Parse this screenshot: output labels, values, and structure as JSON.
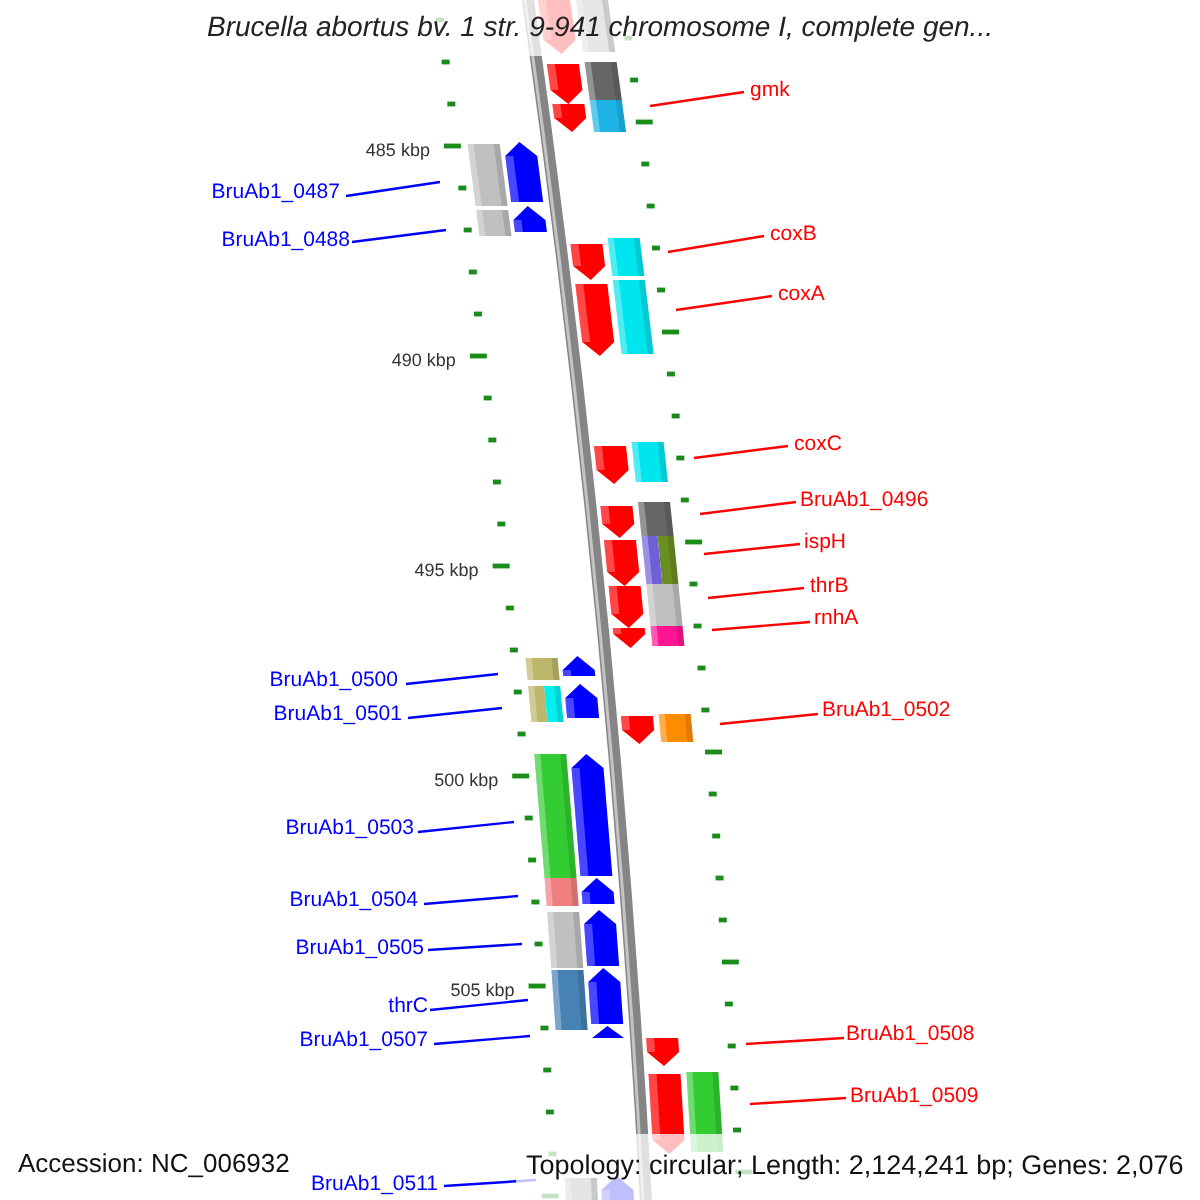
{
  "title": "Brucella abortus bv. 1 str. 9-941 chromosome I, complete gen...",
  "scale_labels": [
    "485 kbp",
    "490 kbp",
    "495 kbp",
    "500 kbp",
    "505 kbp"
  ],
  "genes": [
    {
      "kind": "forward",
      "blocks": [
        {
          "color": "#e6e6e6"
        }
      ]
    },
    {
      "kind": "forward",
      "blocks": [
        {
          "color": "#666666"
        }
      ]
    },
    {
      "label": "gmk",
      "kind": "forward",
      "blocks": [
        {
          "color": "#1eb4e6"
        }
      ]
    },
    {
      "label": "BruAb1_0487",
      "kind": "reverse",
      "blocks": [
        {
          "color": "#c0c0c0"
        }
      ]
    },
    {
      "label": "BruAb1_0488",
      "kind": "reverse",
      "blocks": [
        {
          "color": "#c0c0c0"
        }
      ]
    },
    {
      "label": "coxB",
      "kind": "forward",
      "blocks": [
        {
          "color": "#00e5ee"
        }
      ]
    },
    {
      "label": "coxA",
      "kind": "forward",
      "blocks": [
        {
          "color": "#00e5ee"
        }
      ]
    },
    {
      "label": "coxC",
      "kind": "forward",
      "blocks": [
        {
          "color": "#00e5ee"
        }
      ]
    },
    {
      "label": "BruAb1_0496",
      "kind": "forward",
      "blocks": [
        {
          "color": "#666666"
        }
      ]
    },
    {
      "label": "ispH",
      "kind": "forward",
      "blocks": [
        {
          "color": "#7060d8"
        },
        {
          "color": "#6b8e23"
        }
      ]
    },
    {
      "label": "thrB",
      "kind": "forward",
      "blocks": [
        {
          "color": "#c0c0c0"
        }
      ]
    },
    {
      "label": "rnhA",
      "kind": "forward",
      "blocks": [
        {
          "color": "#ff1493"
        }
      ]
    },
    {
      "label": "BruAb1_0500",
      "kind": "reverse",
      "blocks": [
        {
          "color": "#bdb76b"
        }
      ]
    },
    {
      "label": "BruAb1_0501",
      "kind": "reverse",
      "blocks": [
        {
          "color": "#bdb76b"
        },
        {
          "color": "#00f0f0"
        }
      ]
    },
    {
      "label": "BruAb1_0502",
      "kind": "forward",
      "blocks": [
        {
          "color": "#ff8c00"
        }
      ]
    },
    {
      "label": "BruAb1_0503",
      "kind": "reverse",
      "blocks": [
        {
          "color": "#33cc33"
        }
      ]
    },
    {
      "label": "BruAb1_0504",
      "kind": "reverse",
      "blocks": [
        {
          "color": "#f08080"
        }
      ]
    },
    {
      "label": "BruAb1_0505",
      "kind": "reverse",
      "blocks": [
        {
          "color": "#c0c0c0"
        }
      ]
    },
    {
      "label": "thrC",
      "kind": "reverse",
      "blocks": [
        {
          "color": "#4682b4"
        }
      ]
    },
    {
      "label": "BruAb1_0507",
      "kind": "reverse"
    },
    {
      "label": "BruAb1_0508",
      "kind": "forward"
    },
    {
      "label": "BruAb1_0509",
      "kind": "forward",
      "blocks": [
        {
          "color": "#33cc33"
        }
      ]
    },
    {
      "label": "BruAb1_0511",
      "kind": "reverse",
      "blocks": [
        {
          "color": "#e4e4e4"
        }
      ]
    }
  ],
  "footer": {
    "accession": "Accession: NC_006932",
    "topology": "Topology: circular; Length: 2,124,241 bp; Genes: 2,076"
  }
}
